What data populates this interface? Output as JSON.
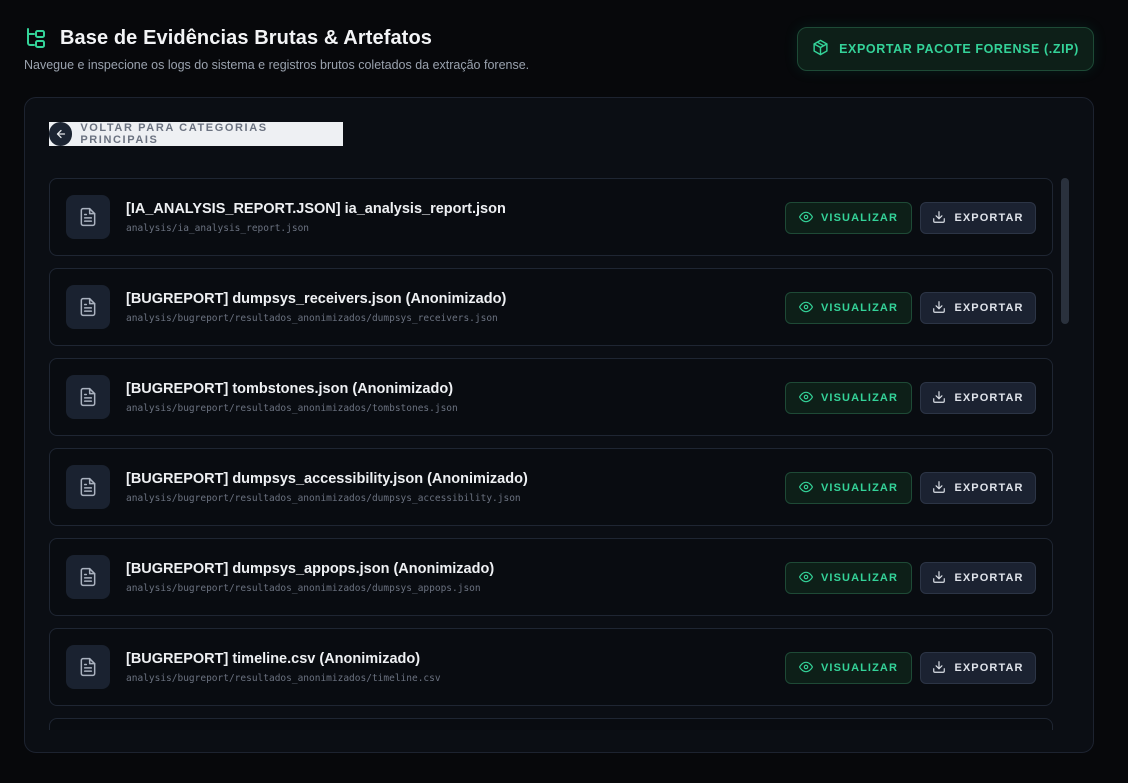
{
  "header": {
    "title": "Base de Evidências Brutas & Artefatos",
    "subtitle": "Navegue e inspecione os logs do sistema e registros brutos coletados da extração forense.",
    "export_button_label": "EXPORTAR PACOTE FORENSE (.ZIP)",
    "title_icon": "folder-tree-icon",
    "export_icon": "package-icon"
  },
  "navigation": {
    "back_label": "VOLTAR PARA CATEGORIAS PRINCIPAIS",
    "back_icon": "arrow-left-icon"
  },
  "files": [
    {
      "title": "[IA_ANALYSIS_REPORT.JSON] ia_analysis_report.json",
      "path": "analysis/ia_analysis_report.json"
    },
    {
      "title": "[BUGREPORT] dumpsys_receivers.json (Anonimizado)",
      "path": "analysis/bugreport/resultados_anonimizados/dumpsys_receivers.json"
    },
    {
      "title": "[BUGREPORT] tombstones.json (Anonimizado)",
      "path": "analysis/bugreport/resultados_anonimizados/tombstones.json"
    },
    {
      "title": "[BUGREPORT] dumpsys_accessibility.json (Anonimizado)",
      "path": "analysis/bugreport/resultados_anonimizados/dumpsys_accessibility.json"
    },
    {
      "title": "[BUGREPORT] dumpsys_appops.json (Anonimizado)",
      "path": "analysis/bugreport/resultados_anonimizados/dumpsys_appops.json"
    },
    {
      "title": "[BUGREPORT] timeline.csv (Anonimizado)",
      "path": "analysis/bugreport/resultados_anonimizados/timeline.csv"
    },
    {
      "title": "",
      "path": ""
    }
  ],
  "actions": {
    "view_label": "VISUALIZAR",
    "export_label": "EXPORTAR",
    "view_icon": "eye-icon",
    "export_icon": "download-icon",
    "file_icon": "file-text-icon"
  },
  "colors": {
    "background": "#07080b",
    "panel": "#0b0e14",
    "accent": "#34d399",
    "accent_bg": "#0d1f18",
    "secondary_button": "#1b2231",
    "muted_text": "#6b7280"
  }
}
